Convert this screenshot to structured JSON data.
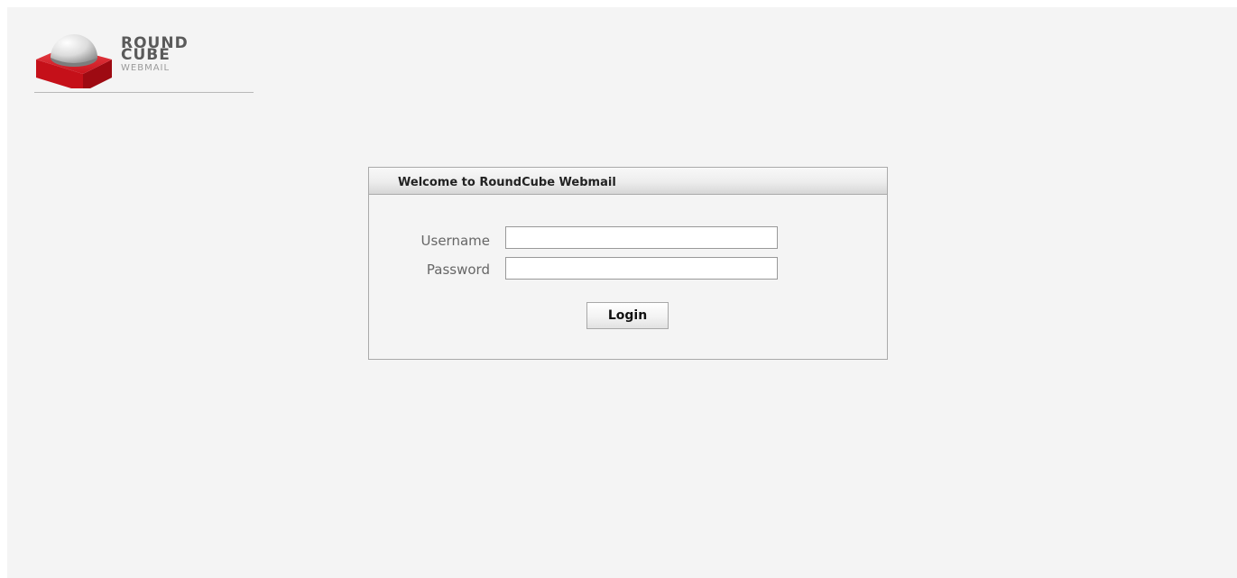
{
  "logo": {
    "line1": "ROUND",
    "line2": "CUBE",
    "line3": "WEBMAIL",
    "icon": "roundcube-logo-icon"
  },
  "login": {
    "title": "Welcome to RoundCube Webmail",
    "username_label": "Username",
    "username_value": "",
    "password_label": "Password",
    "password_value": "",
    "submit_label": "Login"
  },
  "colors": {
    "background": "#f4f4f4",
    "brand_red": "#d4202a",
    "border": "#aaaaaa"
  }
}
